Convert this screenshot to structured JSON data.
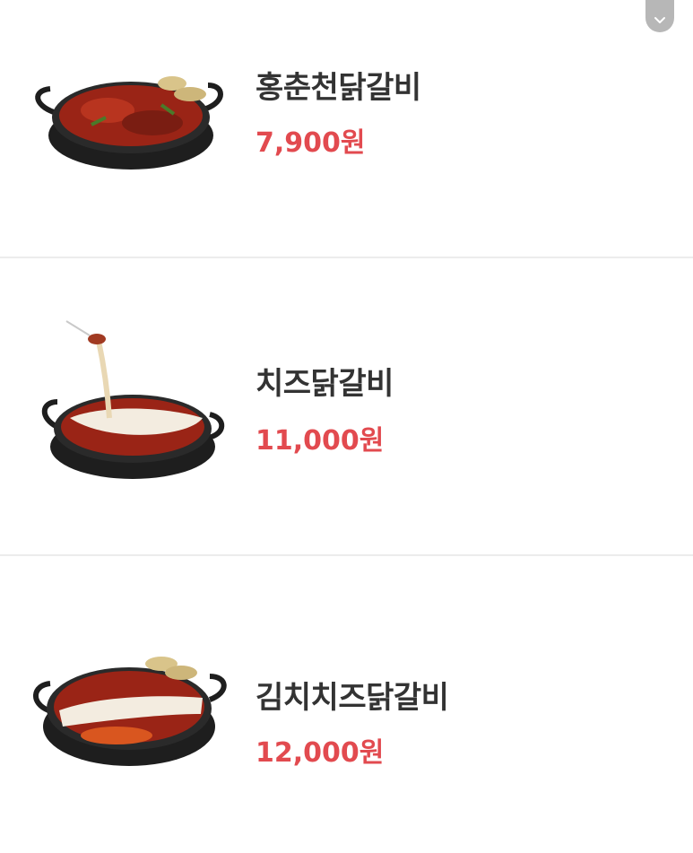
{
  "menu": {
    "items": [
      {
        "name": "홍춘천닭갈비",
        "price": "7,900원",
        "image": "spicy-chicken-galbi-pan"
      },
      {
        "name": "치즈닭갈비",
        "price": "11,000원",
        "image": "cheese-chicken-galbi-pan"
      },
      {
        "name": "김치치즈닭갈비",
        "price": "12,000원",
        "image": "kimchi-cheese-chicken-galbi-pan"
      }
    ]
  },
  "controls": {
    "collapse_icon": "chevron-down-icon"
  },
  "colors": {
    "price": "#e24a4f",
    "name": "#333333",
    "divider": "#ececec",
    "collapse_button": "#b7b7b7"
  }
}
